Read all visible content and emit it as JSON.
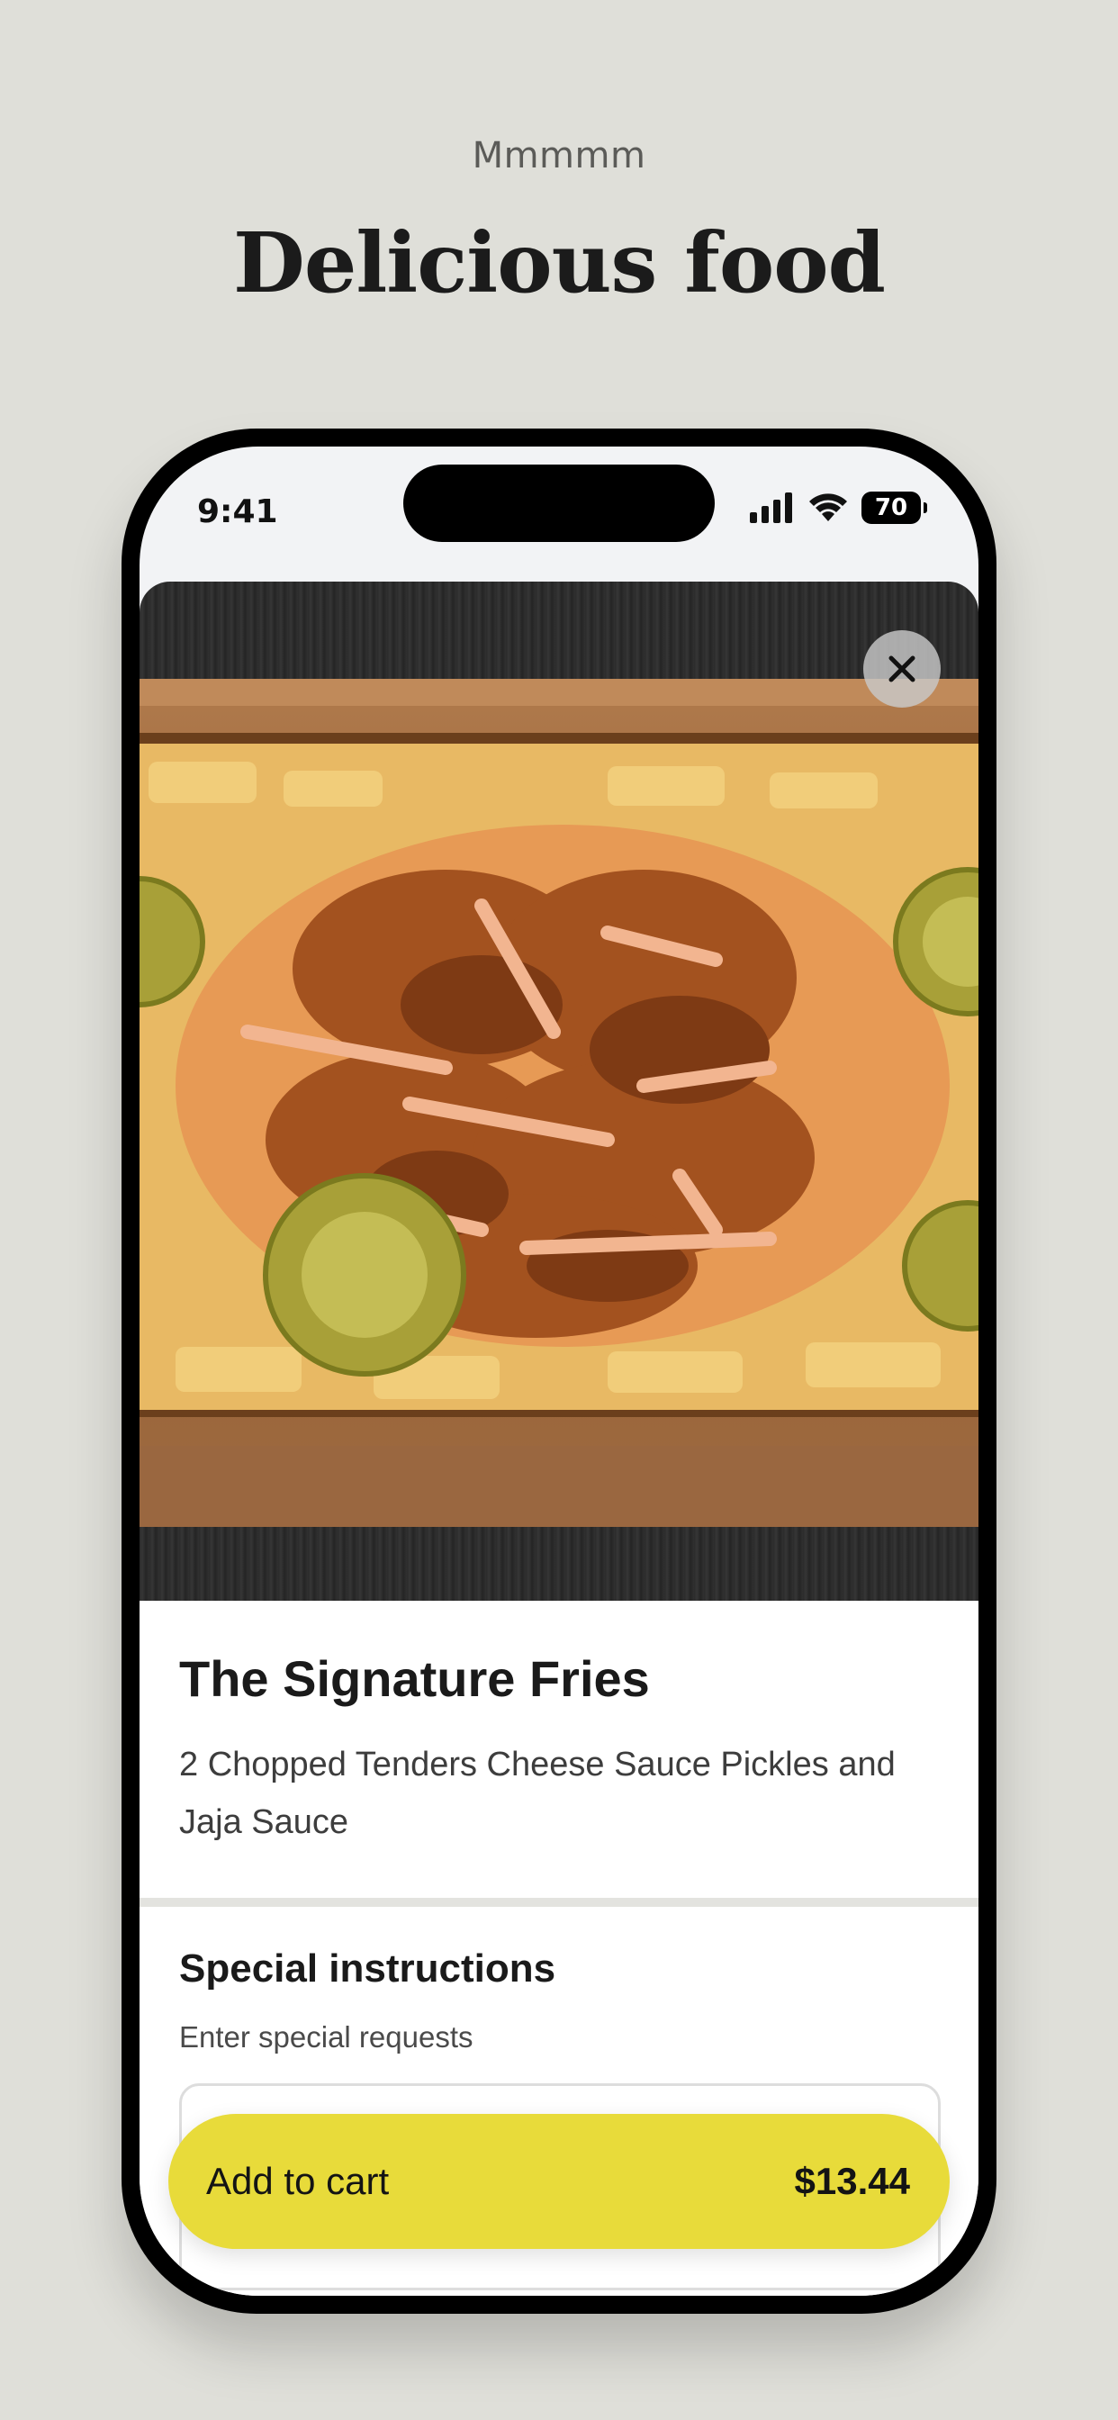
{
  "header": {
    "eyebrow": "Mmmmm",
    "title": "Delicious food"
  },
  "status_bar": {
    "time": "9:41",
    "battery": "70",
    "icons": [
      "signal-icon",
      "wifi-icon",
      "battery-icon"
    ]
  },
  "product": {
    "title": "The Signature Fries",
    "description": "2 Chopped Tenders Cheese Sauce Pickles and Jaja Sauce",
    "image": "signature-fries-photo"
  },
  "instructions": {
    "title": "Special instructions",
    "subtitle": "Enter special requests",
    "value": ""
  },
  "cart": {
    "button_label": "Add to cart",
    "price": "$13.44"
  },
  "colors": {
    "background": "#dfdfd9",
    "accent": "#e8db3a",
    "text": "#1a1a1a"
  }
}
